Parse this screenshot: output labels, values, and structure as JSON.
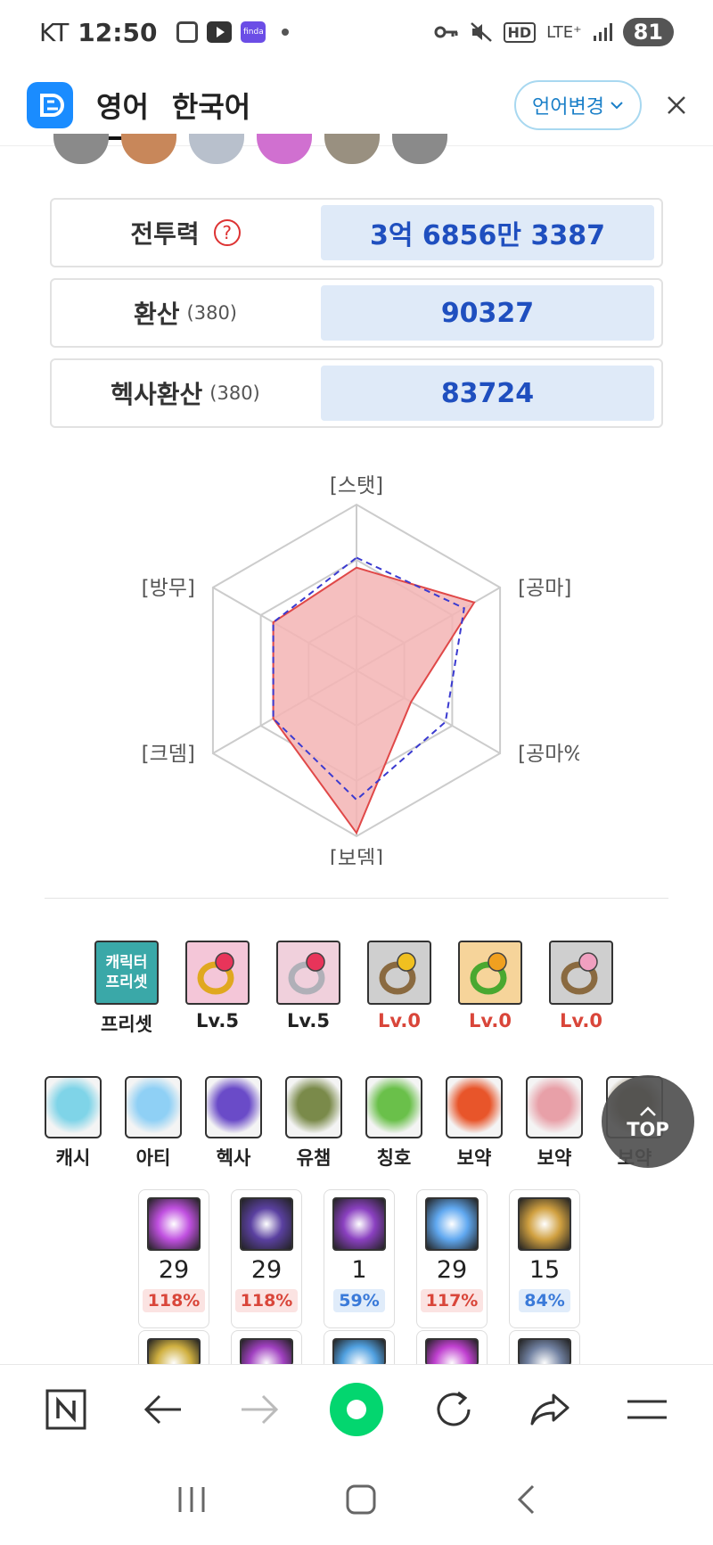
{
  "status_bar": {
    "carrier": "KT",
    "time": "12:50",
    "finda_label": "finda",
    "network": "LTE⁺",
    "hd": "HD",
    "battery": "81"
  },
  "header": {
    "tabs": [
      {
        "label": "영어",
        "active": true
      },
      {
        "label": "한국어",
        "active": false
      }
    ],
    "lang_button": "언어변경",
    "close": "✕"
  },
  "stats": [
    {
      "label": "전투력",
      "sub": "",
      "value": "3억 6856만 3387",
      "has_help": true
    },
    {
      "label": "환산",
      "sub": "(380)",
      "value": "90327",
      "has_help": false
    },
    {
      "label": "헥사환산",
      "sub": "(380)",
      "value": "83724",
      "has_help": false
    }
  ],
  "radar": {
    "axes": [
      "[스탯]",
      "[공마]",
      "[공마%]",
      "[보뎀]",
      "[크뎀]",
      "[방무]"
    ],
    "character": [
      0.62,
      0.82,
      0.38,
      0.98,
      0.58,
      0.58
    ],
    "reference": [
      0.68,
      0.75,
      0.62,
      0.78,
      0.58,
      0.58
    ],
    "colors": {
      "character_fill": "#f3b4b4",
      "character_stroke": "#e04848",
      "reference_stroke": "#3a3ad0",
      "grid": "#cccccc"
    }
  },
  "rings": [
    {
      "label": "프리셋",
      "icon": "character-preset-icon",
      "tag_line1": "캐릭터",
      "tag_line2": "프리셋",
      "zero": false
    },
    {
      "label": "Lv.5",
      "icon": "ring-gold-red-icon",
      "zero": false
    },
    {
      "label": "Lv.5",
      "icon": "ring-silver-red-icon",
      "zero": false
    },
    {
      "label": "Lv.0",
      "icon": "ring-bronze-gold-icon",
      "zero": true
    },
    {
      "label": "Lv.0",
      "icon": "ring-green-gold-icon",
      "zero": true
    },
    {
      "label": "Lv.0",
      "icon": "ring-bronze-pink-icon",
      "zero": true
    }
  ],
  "equipment": [
    {
      "label": "캐시",
      "icon": "cash-helmet-icon",
      "color": "#7fd4e8"
    },
    {
      "label": "아티",
      "icon": "mushroom-icon",
      "color": "#8fd0f5"
    },
    {
      "label": "헥사",
      "icon": "hexa-galaxy-icon",
      "color": "#6a4bc8"
    },
    {
      "label": "유챔",
      "icon": "union-champion-icon",
      "color": "#7a8a4a"
    },
    {
      "label": "칭호",
      "icon": "title-notebook-icon",
      "color": "#6ac04a"
    },
    {
      "label": "보약",
      "icon": "maple-leaf-icon",
      "color": "#e8552a"
    },
    {
      "label": "보약",
      "icon": "girl-portrait-icon",
      "color": "#e8a0a8"
    },
    {
      "label": "보약",
      "icon": "dark-card-icon",
      "color": "#8a7a5a"
    }
  ],
  "top_button": "TOP",
  "skills": [
    {
      "level": "29",
      "pct": "118%",
      "color": "red",
      "icon": "crystal-skill-icon",
      "tint": "#c050e0"
    },
    {
      "level": "29",
      "pct": "118%",
      "color": "red",
      "icon": "dark-orb-skill-icon",
      "tint": "#5a40a0"
    },
    {
      "level": "1",
      "pct": "59%",
      "color": "blue",
      "icon": "purple-rune-skill-icon",
      "tint": "#8a40c0"
    },
    {
      "level": "29",
      "pct": "117%",
      "color": "red",
      "icon": "ice-crystal-skill-icon",
      "tint": "#60a8f0"
    },
    {
      "level": "15",
      "pct": "84%",
      "color": "blue",
      "icon": "golden-portal-skill-icon",
      "tint": "#d0a040"
    }
  ],
  "skills_row2": [
    {
      "icon": "skill-partial-1-icon",
      "tint": "#d0b040"
    },
    {
      "icon": "skill-partial-2-icon",
      "tint": "#a040c0"
    },
    {
      "icon": "skill-partial-3-icon",
      "tint": "#50a0e0"
    },
    {
      "icon": "skill-partial-4-icon",
      "tint": "#c040d0"
    },
    {
      "icon": "skill-partial-5-icon",
      "tint": "#7080a0"
    }
  ],
  "browser": {
    "home_label": "N"
  }
}
